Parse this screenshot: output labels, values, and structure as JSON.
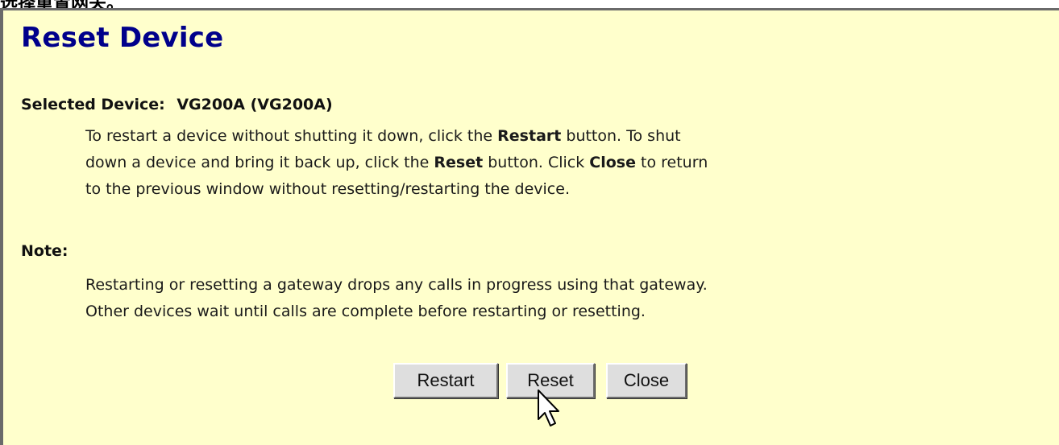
{
  "caption": "选择重置网关。",
  "window": {
    "title": "Reset Device",
    "selected_label": "Selected Device:",
    "selected_value": "VG200A (VG200A)",
    "instructions": {
      "line1_pre": "To restart a device without shutting it down, click the ",
      "line1_bold": "Restart",
      "line1_post": " button. To shut",
      "line2_pre": "down a device and bring it back up, click the ",
      "line2_bold1": "Reset",
      "line2_mid": " button. Click ",
      "line2_bold2": "Close",
      "line2_post": " to return",
      "line3": "to the previous window without resetting/restarting the device."
    },
    "note_label": "Note:",
    "note": {
      "line1": "Restarting or resetting a gateway drops any calls in progress using that gateway.",
      "line2": "Other devices wait until calls are complete before restarting or resetting."
    },
    "buttons": {
      "restart": "Restart",
      "reset": "Reset",
      "close": "Close"
    }
  }
}
